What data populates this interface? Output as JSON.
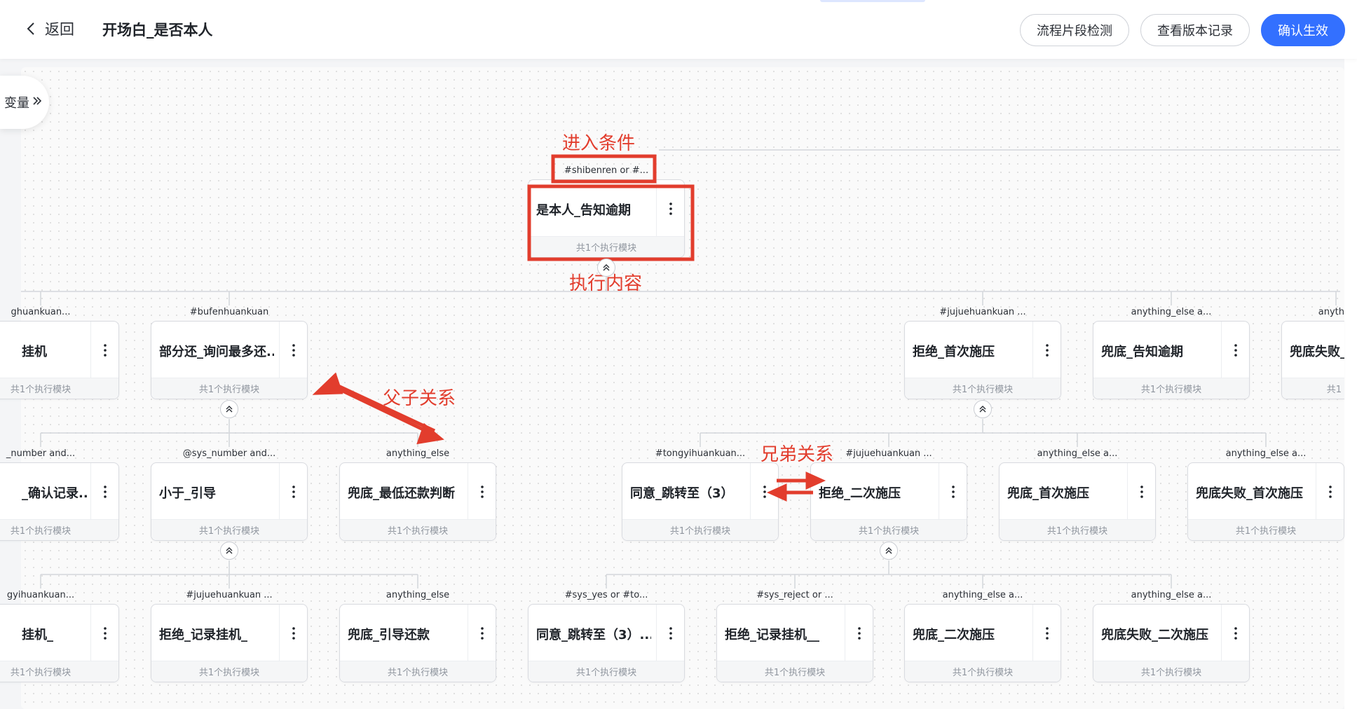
{
  "header": {
    "back_label": "返回",
    "title": "开场白_是否本人",
    "buttons": {
      "check": "流程片段检测",
      "versions": "查看版本记录",
      "confirm": "确认生效"
    },
    "colors": {
      "primary": "#3370ff"
    }
  },
  "sidebar": {
    "variables_label": "变量",
    "toggle_icon": "double-chevron-right-icon"
  },
  "node_footer": "共1个执行模块",
  "nodes": {
    "root": {
      "condition": "#shibenren or #...",
      "title": "是本人_告知逾期"
    },
    "l1_a": {
      "condition": "ghuankuan...",
      "title": "挂机"
    },
    "l1_b": {
      "condition": "#bufenhuankuan",
      "title": "部分还_询问最多还..."
    },
    "l1_c": {
      "condition": "#jujuehuankuan ...",
      "title": "拒绝_首次施压"
    },
    "l1_d": {
      "condition": "anything_else a...",
      "title": "兜底_告知逾期"
    },
    "l1_e": {
      "condition": "anyth",
      "title": "兜底失败_",
      "footer": "共1"
    },
    "l2_a": {
      "condition": "_number and...",
      "title": "_确认记录..."
    },
    "l2_b": {
      "condition": "@sys_number and...",
      "title": "小于_引导"
    },
    "l2_c": {
      "condition": "anything_else",
      "title": "兜底_最低还款判断"
    },
    "l2_d": {
      "condition": "#tongyihuankuan...",
      "title": "同意_跳转至（3）"
    },
    "l2_e": {
      "condition": "#jujuehuankuan ...",
      "title": "拒绝_二次施压"
    },
    "l2_f": {
      "condition": "anything_else a...",
      "title": "兜底_首次施压"
    },
    "l2_g": {
      "condition": "anything_else a...",
      "title": "兜底失败_首次施压"
    },
    "l3_a": {
      "condition": "gyihuankuan...",
      "title": "挂机_"
    },
    "l3_b": {
      "condition": "#jujuehuankuan ...",
      "title": "拒绝_记录挂机_"
    },
    "l3_c": {
      "condition": "anything_else",
      "title": "兜底_引导还款"
    },
    "l3_d": {
      "condition": "#sys_yes or #to...",
      "title": "同意_跳转至（3）..."
    },
    "l3_e": {
      "condition": "#sys_reject or ...",
      "title": "拒绝_记录挂机__"
    },
    "l3_f": {
      "condition": "anything_else a...",
      "title": "兜底_二次施压"
    },
    "l3_g": {
      "condition": "anything_else a...",
      "title": "兜底失败_二次施压"
    }
  },
  "annotations": {
    "entry_condition": "进入条件",
    "execution_content": "执行内容",
    "parent_child": "父子关系",
    "sibling": "兄弟关系",
    "color": "#e23d2d"
  }
}
